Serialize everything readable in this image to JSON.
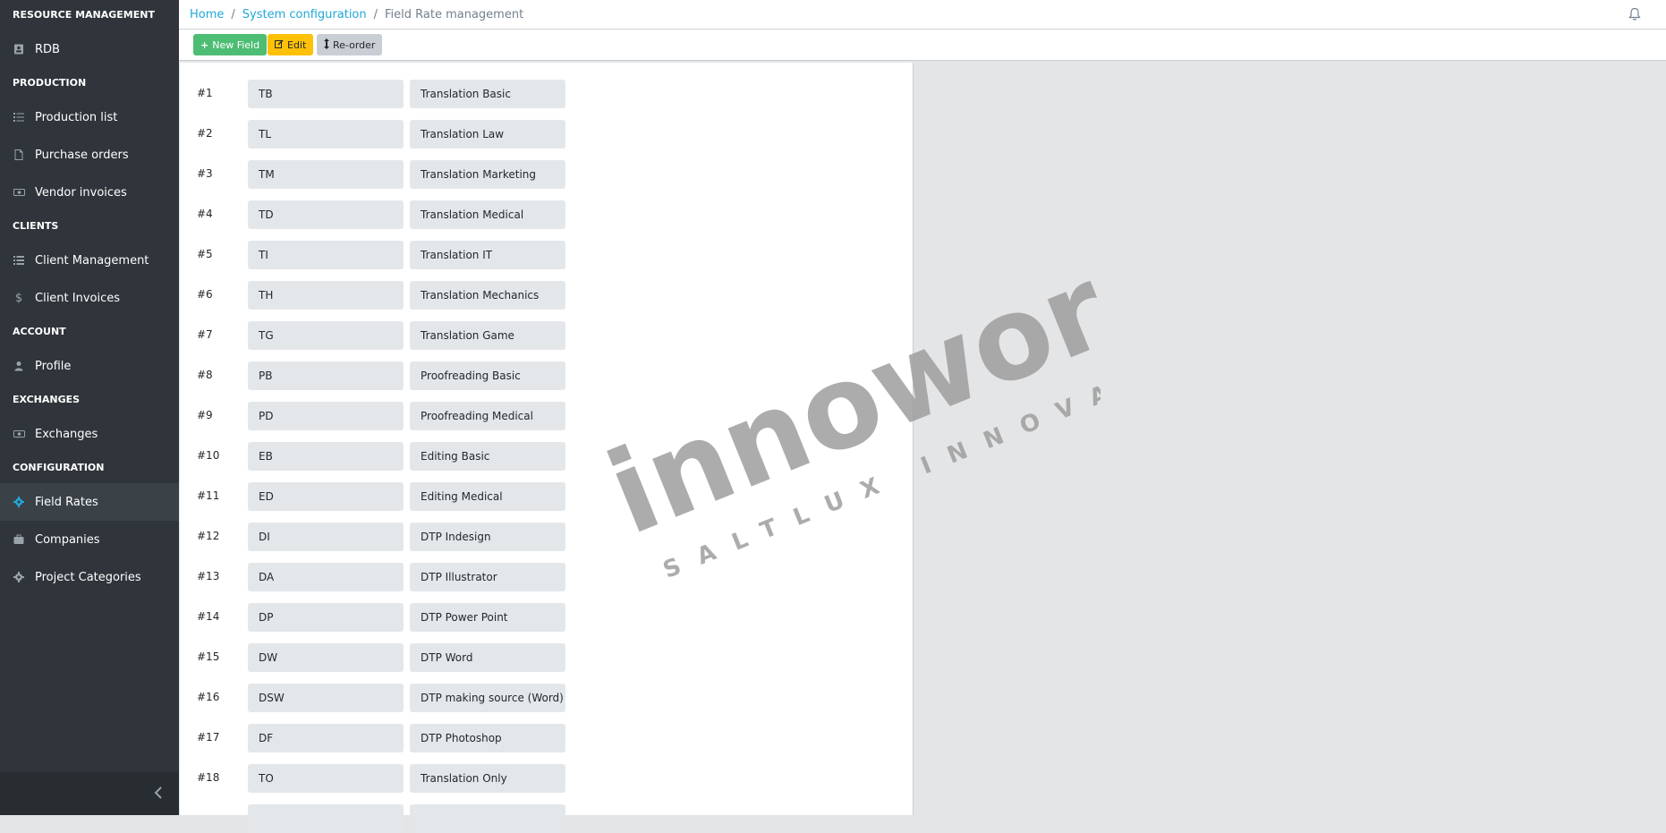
{
  "sidebar": {
    "sections": [
      {
        "title": "RESOURCE MANAGEMENT",
        "items": [
          {
            "label": "RDB",
            "icon": "contact-card-icon"
          }
        ]
      },
      {
        "title": "PRODUCTION",
        "items": [
          {
            "label": "Production list",
            "icon": "list-icon"
          },
          {
            "label": "Purchase orders",
            "icon": "file-icon"
          },
          {
            "label": "Vendor invoices",
            "icon": "money-icon"
          }
        ]
      },
      {
        "title": "CLIENTS",
        "items": [
          {
            "label": "Client Management",
            "icon": "list-icon"
          },
          {
            "label": "Client Invoices",
            "icon": "dollar-icon"
          }
        ]
      },
      {
        "title": "ACCOUNT",
        "items": [
          {
            "label": "Profile",
            "icon": "user-icon"
          }
        ]
      },
      {
        "title": "EXCHANGES",
        "items": [
          {
            "label": "Exchanges",
            "icon": "money-icon"
          }
        ]
      },
      {
        "title": "CONFIGURATION",
        "items": [
          {
            "label": "Field Rates",
            "icon": "gear-icon",
            "active": true
          },
          {
            "label": "Companies",
            "icon": "briefcase-icon"
          },
          {
            "label": "Project Categories",
            "icon": "gear-icon"
          }
        ]
      }
    ]
  },
  "breadcrumb": {
    "home": "Home",
    "parent": "System configuration",
    "current": "Field Rate management",
    "separator": "/"
  },
  "toolbar": {
    "new_label": "New Field",
    "edit_label": "Edit",
    "reorder_label": "Re-order"
  },
  "fields": [
    {
      "num": "#1",
      "code": "TB",
      "name": "Translation Basic"
    },
    {
      "num": "#2",
      "code": "TL",
      "name": "Translation Law"
    },
    {
      "num": "#3",
      "code": "TM",
      "name": "Translation Marketing"
    },
    {
      "num": "#4",
      "code": "TD",
      "name": "Translation Medical"
    },
    {
      "num": "#5",
      "code": "TI",
      "name": "Translation IT"
    },
    {
      "num": "#6",
      "code": "TH",
      "name": "Translation Mechanics"
    },
    {
      "num": "#7",
      "code": "TG",
      "name": "Translation Game"
    },
    {
      "num": "#8",
      "code": "PB",
      "name": "Proofreading Basic"
    },
    {
      "num": "#9",
      "code": "PD",
      "name": "Proofreading Medical"
    },
    {
      "num": "#10",
      "code": "EB",
      "name": "Editing Basic"
    },
    {
      "num": "#11",
      "code": "ED",
      "name": "Editing Medical"
    },
    {
      "num": "#12",
      "code": "DI",
      "name": "DTP Indesign"
    },
    {
      "num": "#13",
      "code": "DA",
      "name": "DTP Illustrator"
    },
    {
      "num": "#14",
      "code": "DP",
      "name": "DTP Power Point"
    },
    {
      "num": "#15",
      "code": "DW",
      "name": "DTP Word"
    },
    {
      "num": "#16",
      "code": "DSW",
      "name": " DTP making source (Word)"
    },
    {
      "num": "#17",
      "code": "DF",
      "name": "DTP Photoshop"
    },
    {
      "num": "#18",
      "code": "TO",
      "name": "Translation Only"
    },
    {
      "num": "",
      "code": "",
      "name": ""
    }
  ],
  "watermark": {
    "brand": "innoword",
    "tagline": "SALTLUX INNOVATION"
  },
  "colors": {
    "sidebar_bg": "#2f353a",
    "link": "#20a8d8",
    "btn_new": "#4dbd74",
    "btn_edit": "#ffc107",
    "btn_reorder": "#c8ced3",
    "field_bg": "#e4e7ea"
  }
}
